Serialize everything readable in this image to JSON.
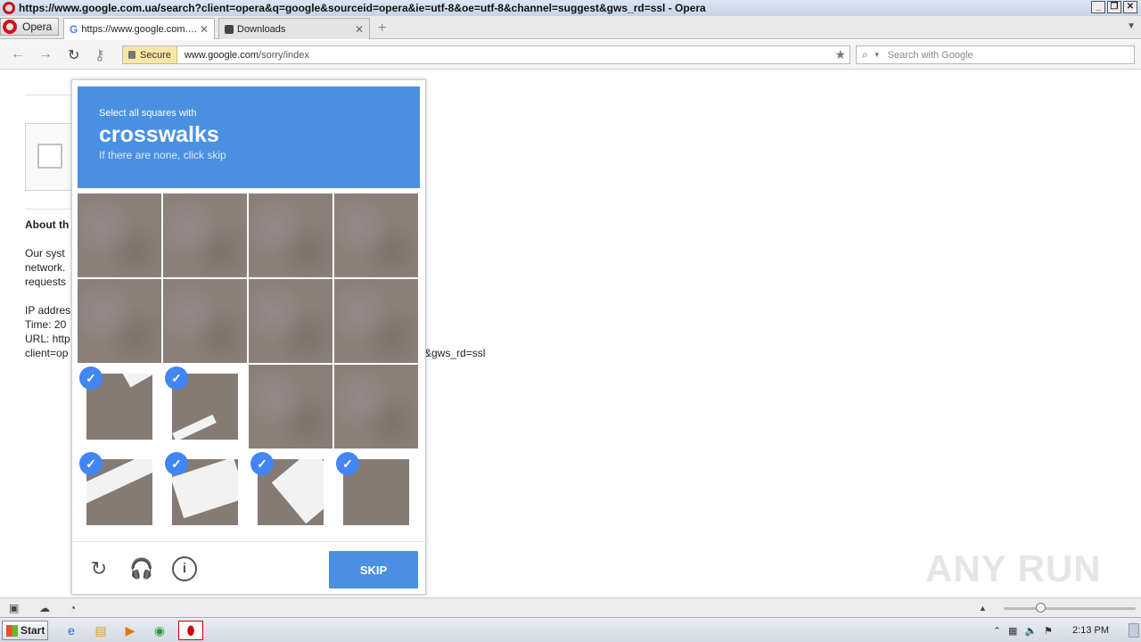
{
  "window": {
    "title": "https://www.google.com.ua/search?client=opera&q=google&sourceid=opera&ie=utf-8&oe=utf-8&channel=suggest&gws_rd=ssl - Opera"
  },
  "tabs": {
    "menu_label": "Opera",
    "active_label": "https://www.google.com.ua/search?client=opera",
    "inactive_label": "Downloads"
  },
  "navbar": {
    "secure_label": "Secure",
    "url_host": "www.google.com",
    "url_path": "/sorry/index",
    "search_placeholder": "Search with Google"
  },
  "background_page": {
    "heading": "About th",
    "lines": [
      "Our syst",
      "network.",
      "requests",
      "IP addres",
      "Time: 20",
      "URL: http",
      "client=op"
    ],
    "url_tail": "&gws_rd=ssl"
  },
  "captcha": {
    "instruction": "Select all squares with",
    "target": "crosswalks",
    "hint": "If there are none, click skip",
    "skip_label": "SKIP",
    "selected_tiles": [
      8,
      9,
      12,
      13,
      14,
      15
    ]
  },
  "watermark": "ANY RUN",
  "taskbar": {
    "start_label": "Start",
    "clock": "2:13 PM"
  }
}
